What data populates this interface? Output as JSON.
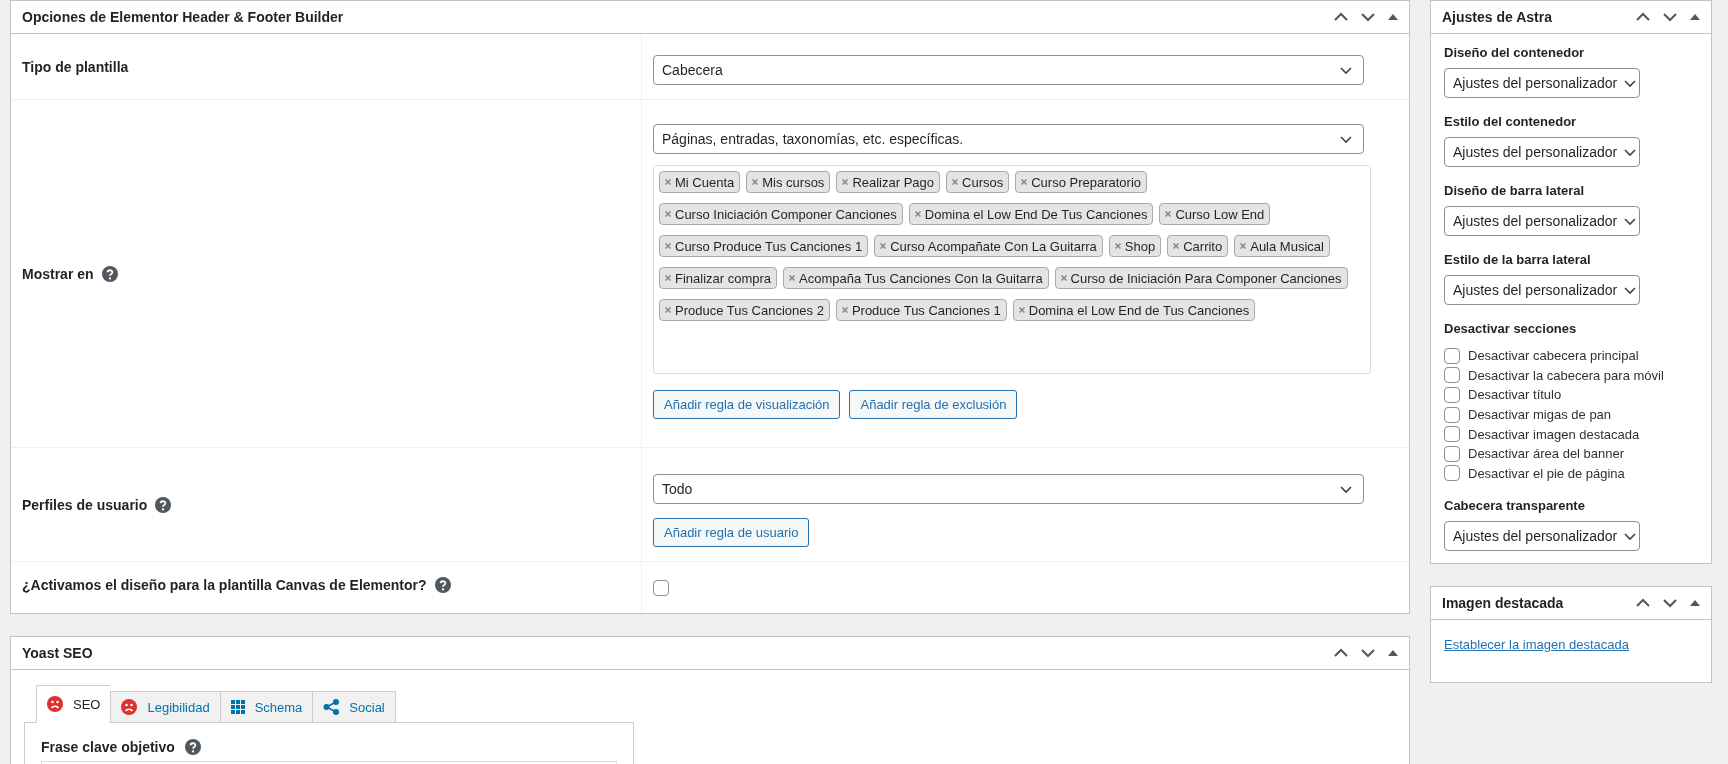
{
  "elementor_options": {
    "title": "Opciones de Elementor Header & Footer Builder",
    "rows": [
      {
        "kind": "select",
        "label": "Tipo de plantilla",
        "help": false,
        "value": "Cabecera"
      },
      {
        "kind": "rules",
        "label": "Mostrar en",
        "help": true,
        "value": "Páginas, entradas, taxonomías, etc. específicas.",
        "tags": [
          "Mi Cuenta",
          "Mis cursos",
          "Realizar Pago",
          "Cursos",
          "Curso Preparatorio",
          "Curso Iniciación Componer Canciones",
          "Domina el Low End De Tus Canciones",
          "Curso Low End",
          "Curso Produce Tus Canciones 1",
          "Curso Acompañate Con La Guitarra",
          "Shop",
          "Carrito",
          "Aula Musical",
          "Finalizar compra",
          "Acompaña Tus Canciones Con la Guitarra",
          "Curso de Iniciación Para Componer Canciones",
          "Produce Tus Canciones 2",
          "Produce Tus Canciones 1",
          "Domina el Low End de Tus Canciones"
        ],
        "buttons": [
          "Añadir regla de visualización",
          "Añadir regla de exclusión"
        ]
      },
      {
        "kind": "select",
        "label": "Perfiles de usuario",
        "help": true,
        "value": "Todo",
        "buttons": [
          "Añadir regla de usuario"
        ]
      },
      {
        "kind": "checkbox",
        "label": "¿Activamos el diseño para la plantilla Canvas de Elementor?",
        "help": true,
        "checked": false
      }
    ]
  },
  "yoast": {
    "title": "Yoast SEO",
    "tabs": [
      {
        "label": "SEO",
        "selected": true
      },
      {
        "label": "Legibilidad",
        "selected": false
      },
      {
        "label": "Schema",
        "selected": false
      },
      {
        "label": "Social",
        "selected": false
      }
    ],
    "field_label": "Frase clave objetivo"
  },
  "astra": {
    "title": "Ajustes de Astra",
    "selects": [
      {
        "label": "Diseño del contenedor",
        "value": "Ajustes del personalizador"
      },
      {
        "label": "Estilo del contenedor",
        "value": "Ajustes del personalizador"
      },
      {
        "label": "Diseño de barra lateral",
        "value": "Ajustes del personalizador"
      },
      {
        "label": "Estilo de la barra lateral",
        "value": "Ajustes del personalizador"
      }
    ],
    "sections_label": "Desactivar secciones",
    "checkboxes": [
      {
        "label": "Desactivar cabecera principal",
        "checked": false
      },
      {
        "label": "Desactivar la cabecera para móvil",
        "checked": false
      },
      {
        "label": "Desactivar título",
        "checked": false
      },
      {
        "label": "Desactivar migas de pan",
        "checked": false
      },
      {
        "label": "Desactivar imagen destacada",
        "checked": false
      },
      {
        "label": "Desactivar área del banner",
        "checked": false
      },
      {
        "label": "Desactivar el pie de página",
        "checked": false
      }
    ],
    "transparent": {
      "label": "Cabecera transparente",
      "value": "Ajustes del personalizador"
    }
  },
  "featured_image": {
    "title": "Imagen destacada",
    "link": "Establecer la imagen destacada"
  }
}
